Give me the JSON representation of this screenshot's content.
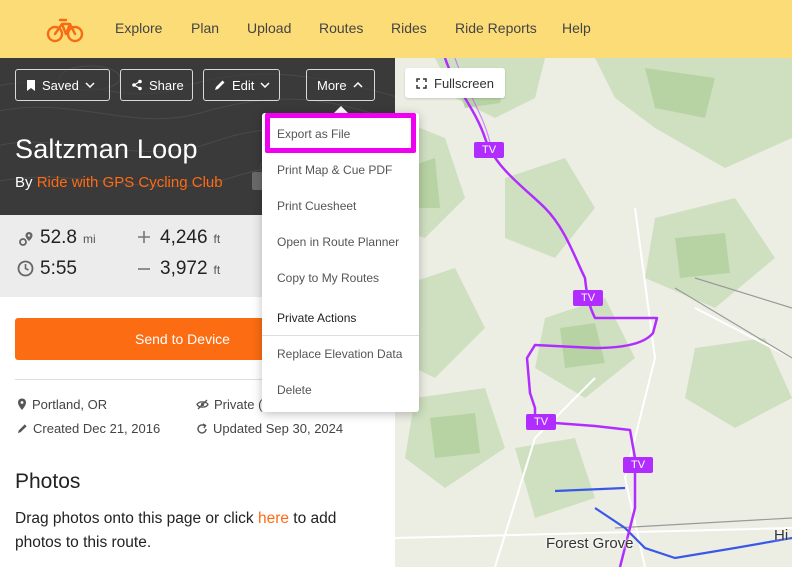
{
  "nav": {
    "items": [
      "Explore",
      "Plan",
      "Upload",
      "Routes",
      "Rides",
      "Ride Reports",
      "Help"
    ]
  },
  "toolbar": {
    "saved_label": "Saved",
    "share_label": "Share",
    "edit_label": "Edit",
    "more_label": "More",
    "fullscreen_label": "Fullscreen"
  },
  "route": {
    "title": "Saltzman Loop",
    "by_prefix": "By",
    "author": "Ride with GPS Cycling Club"
  },
  "stats": {
    "distance": {
      "value": "52.8",
      "unit": "mi"
    },
    "elevation_gain": {
      "value": "4,246",
      "unit": "ft"
    },
    "duration": {
      "value": "5:55"
    },
    "elevation_loss": {
      "value": "3,972",
      "unit": "ft"
    }
  },
  "send_to_device": "Send to Device",
  "meta": {
    "location": "Portland, OR",
    "privacy": "Private (",
    "created": "Created Dec 21, 2016",
    "updated": "Updated Sep 30, 2024"
  },
  "photos": {
    "title": "Photos",
    "text_before": "Drag photos onto this page or click ",
    "link": "here",
    "text_after": " to add photos to this route."
  },
  "more_menu": {
    "items": [
      "Export as File",
      "Print Map & Cue PDF",
      "Print Cuesheet",
      "Open in Route Planner",
      "Copy to My Routes"
    ],
    "section_label": "Private Actions",
    "private_items": [
      "Replace Elevation Data",
      "Delete"
    ]
  },
  "map": {
    "labels": {
      "forest_grove": "Forest Grove",
      "edge": "Hi"
    },
    "route_badges": [
      "TV",
      "TV",
      "TV",
      "TV"
    ]
  },
  "colors": {
    "nav_bg": "#fcdc77",
    "accent": "#fc6c12",
    "route_line": "#b12dff",
    "highlight": "#f000f0"
  }
}
